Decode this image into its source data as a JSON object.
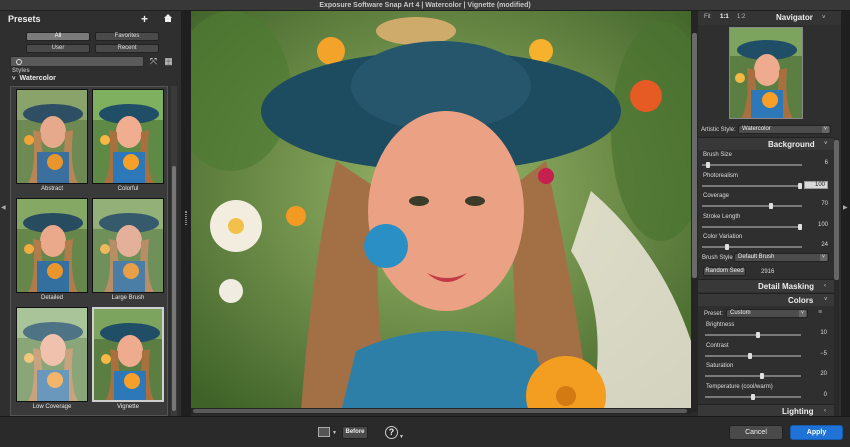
{
  "window": {
    "title": "Exposure Software Snap Art 4 | Watercolor | Vignette (modified)"
  },
  "presets": {
    "title": "Presets",
    "filters": {
      "all": "All",
      "favorites": "Favorites",
      "user": "User",
      "recent": "Recent"
    },
    "section_cut": "Styles",
    "group": "Watercolor",
    "items": [
      {
        "label": "Abstract"
      },
      {
        "label": "Colorful"
      },
      {
        "label": "Detailed"
      },
      {
        "label": "Large Brush"
      },
      {
        "label": "Low Coverage"
      },
      {
        "label": "Vignette"
      }
    ]
  },
  "navigator": {
    "title": "Navigator",
    "zoom": {
      "fit": "Fit",
      "one": "1:1",
      "half": "1:2"
    }
  },
  "artistic_style": {
    "label": "Artistic Style:",
    "value": "Watercolor"
  },
  "background": {
    "title": "Background",
    "sliders": [
      {
        "label": "Brush Size",
        "value": "6",
        "fraction": 0.04
      },
      {
        "label": "Photorealism",
        "value": "100",
        "fraction": 1.0
      },
      {
        "label": "Coverage",
        "value": "70",
        "fraction": 0.7
      },
      {
        "label": "Stroke Length",
        "value": "100",
        "fraction": 1.0
      },
      {
        "label": "Color Variation",
        "value": "24",
        "fraction": 0.24
      }
    ],
    "brush_style": {
      "label": "Brush Style",
      "value": "Default Brush"
    },
    "random_seed": {
      "label": "Random Seed",
      "value": "2916"
    }
  },
  "detail_masking": {
    "title": "Detail Masking"
  },
  "colors": {
    "title": "Colors",
    "preset": {
      "label": "Preset:",
      "value": "Custom"
    },
    "sliders": [
      {
        "label": "Brightness",
        "value": "10",
        "fraction": 0.55
      },
      {
        "label": "Contrast",
        "value": "−5",
        "fraction": 0.47
      },
      {
        "label": "Saturation",
        "value": "20",
        "fraction": 0.6
      },
      {
        "label": "Temperature (cool/warm)",
        "value": "0",
        "fraction": 0.5
      }
    ]
  },
  "lighting": {
    "title": "Lighting"
  },
  "bottom": {
    "before_label": "Before",
    "help_label": "?",
    "cancel_label": "Cancel",
    "apply_label": "Apply"
  },
  "colors_ui": {
    "accent": "#1f73d6",
    "panel": "#2f2f2f",
    "selected_thumb_border": "#d0d0d0"
  }
}
